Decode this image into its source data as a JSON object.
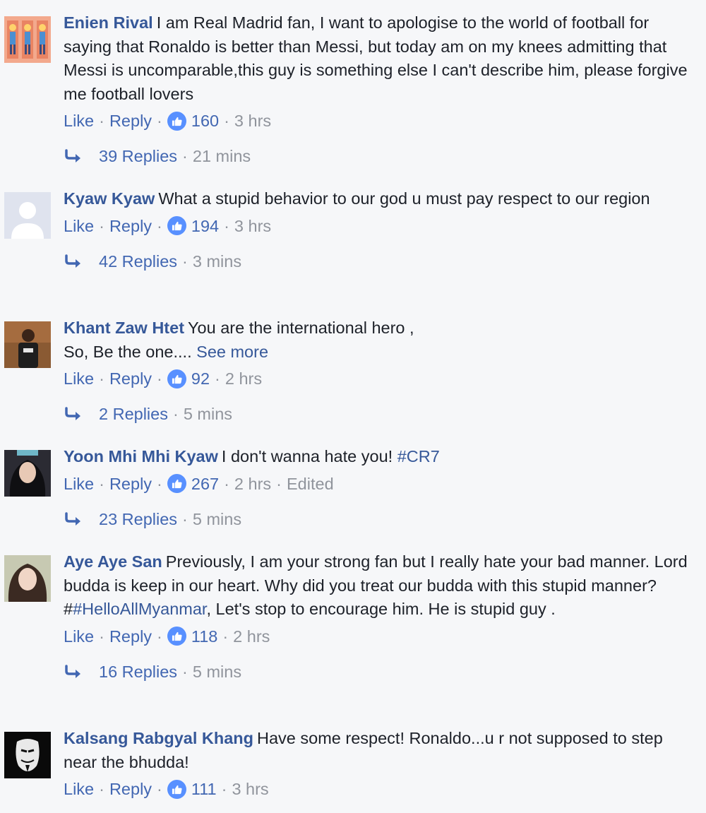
{
  "labels": {
    "like": "Like",
    "reply": "Reply",
    "see_more": "See more"
  },
  "colors": {
    "link": "#365899",
    "meta": "#90949c",
    "like_bubble": "#5890ff",
    "background": "#f6f7f9"
  },
  "comments": [
    {
      "author": "Enien Rival",
      "text": "I am Real Madrid fan, I want to apologise to the world of football for saying that Ronaldo is better than Messi, but today am on my knees admitting that Messi is uncomparable,this guy is something else I can't describe him, please forgive me football lovers",
      "likes": "160",
      "time": "3 hrs",
      "replies": "39 Replies",
      "reply_time": "21 mins",
      "avatar": "cartoon-figures-avatar"
    },
    {
      "author": "Kyaw Kyaw",
      "text": "What a stupid behavior to our god u must pay respect to our region",
      "likes": "194",
      "time": "3 hrs",
      "replies": "42 Replies",
      "reply_time": "3 mins",
      "avatar": "default-silhouette-avatar"
    },
    {
      "author": "Khant Zaw Htet",
      "text_line1": "You are the international hero ,",
      "text_line2": "So, Be the one....",
      "likes": "92",
      "time": "2 hrs",
      "replies": "2 Replies",
      "reply_time": "5 mins",
      "avatar": "person-photo-avatar"
    },
    {
      "author": "Yoon Mhi Mhi Kyaw",
      "text": "I don't wanna hate you!",
      "hashtag": "#CR7",
      "likes": "267",
      "time": "2 hrs",
      "edited": "Edited",
      "replies": "23 Replies",
      "reply_time": "5 mins",
      "avatar": "portrait-photo-avatar"
    },
    {
      "author": "Aye Aye San",
      "text_before": "Previously, I am your strong fan but I really hate your bad manner. Lord budda is keep in our heart. Why did you treat our budda with this stupid manner? #",
      "hashtag": "#HelloAllMyanmar",
      "text_after": ", Let's stop to encourage him. He is stupid guy .",
      "likes": "118",
      "time": "2 hrs",
      "replies": "16 Replies",
      "reply_time": "5 mins",
      "avatar": "portrait-photo-avatar"
    },
    {
      "author": "Kalsang Rabgyal Khang",
      "text": "Have some respect! Ronaldo...u r not supposed to step near the bhudda!",
      "likes": "111",
      "time": "3 hrs",
      "avatar": "mask-avatar"
    }
  ]
}
